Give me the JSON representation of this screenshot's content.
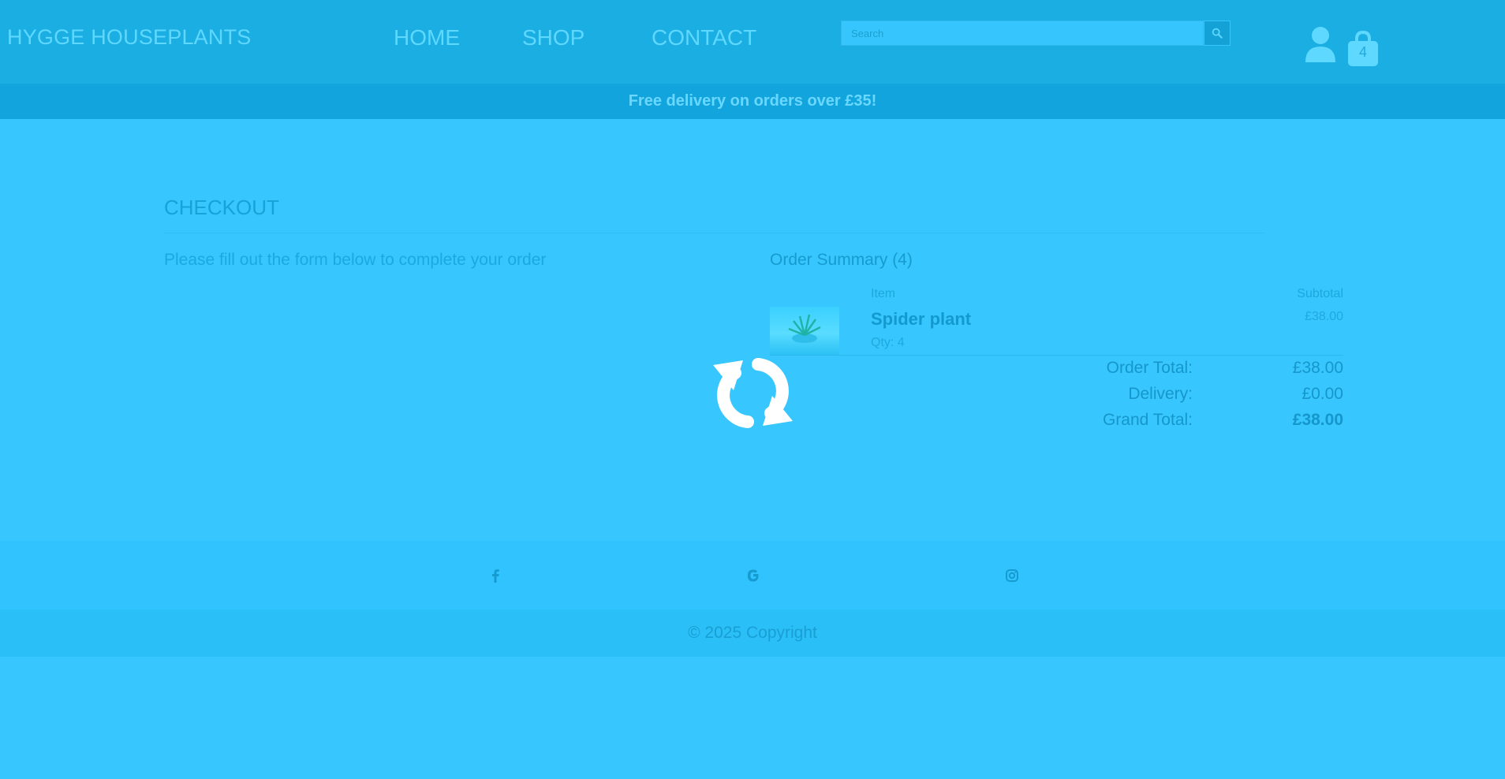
{
  "header": {
    "brand": "HYGGE HOUSEPLANTS",
    "nav": [
      {
        "label": "HOME"
      },
      {
        "label": "SHOP"
      },
      {
        "label": "CONTACT"
      }
    ],
    "search": {
      "placeholder": "Search",
      "value": ""
    },
    "bag_count": "4"
  },
  "banner": {
    "text": "Free delivery on orders over £35!"
  },
  "checkout": {
    "title": "CHECKOUT",
    "intro": "Please fill out the form below to complete your order"
  },
  "summary": {
    "title": "Order Summary (4)",
    "col_item": "Item",
    "col_subtotal": "Subtotal",
    "items": [
      {
        "name": "Spider plant",
        "qty": "Qty: 4",
        "subtotal": "£38.00"
      }
    ],
    "order_total_label": "Order Total:",
    "order_total": "£38.00",
    "delivery_label": "Delivery:",
    "delivery": "£0.00",
    "grand_total_label": "Grand Total:",
    "grand_total": "£38.00"
  },
  "footer": {
    "social": [
      "facebook-icon",
      "google-icon",
      "instagram-icon"
    ],
    "copyright": "© 2025 Copyright"
  },
  "icons": {
    "search": "search-icon",
    "account": "account-icon",
    "bag": "shopping-bag-icon",
    "loading": "refresh-spinner-icon"
  },
  "colors": {
    "overlay_blue": "#37c6fd",
    "header_blue": "#1aaee3",
    "banner_blue": "#12a5dd"
  }
}
